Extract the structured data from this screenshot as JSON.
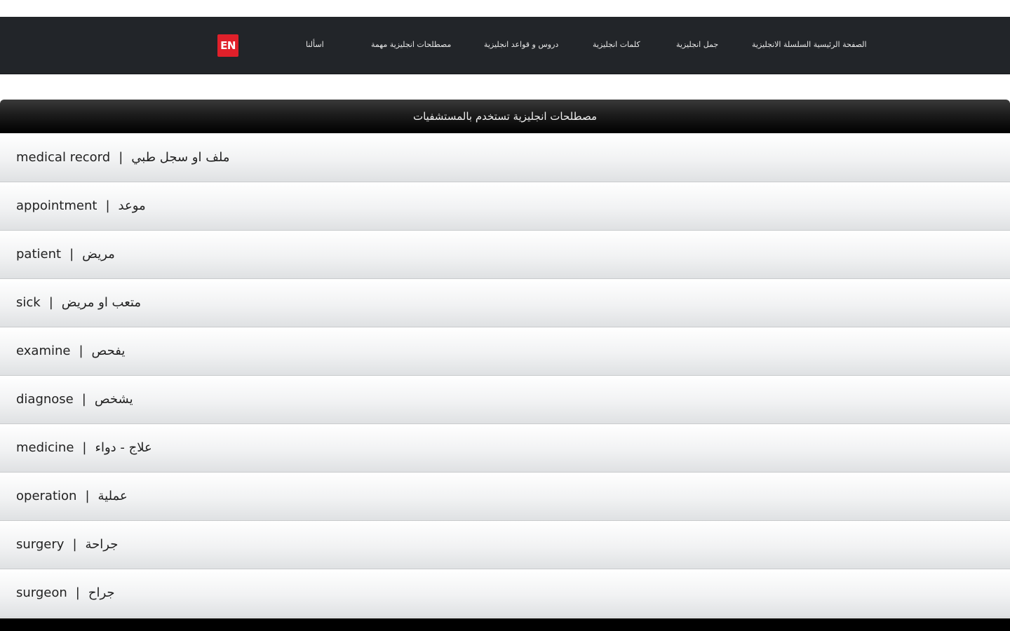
{
  "nav": {
    "logo": "EN",
    "links": [
      "اسألنا",
      "مصطلحات انجليزية مهمة",
      "دروس و قواعد انجليزية",
      "كلمات انجليزية",
      "جمل انجليزية",
      "الصفحة الرئيسية السلسلة الانجليزية"
    ]
  },
  "section": {
    "title": "مصطلحات انجليزية تستخدم بالمستشفيات"
  },
  "terms": [
    {
      "en": "medical record",
      "sep": "|",
      "ar": "ملف او سجل طبي"
    },
    {
      "en": "appointment",
      "sep": "|",
      "ar": "موعد"
    },
    {
      "en": "patient",
      "sep": "|",
      "ar": "مريض"
    },
    {
      "en": "sick",
      "sep": "|",
      "ar": "متعب او مريض"
    },
    {
      "en": "examine",
      "sep": "|",
      "ar": "يفحص"
    },
    {
      "en": "diagnose",
      "sep": "|",
      "ar": "يشخص"
    },
    {
      "en": "medicine",
      "sep": "|",
      "ar": "علاج - دواء"
    },
    {
      "en": "operation",
      "sep": "|",
      "ar": "عملية"
    },
    {
      "en": "surgery",
      "sep": "|",
      "ar": "جراحة"
    },
    {
      "en": "surgeon",
      "sep": "|",
      "ar": "جراح"
    }
  ],
  "colors": {
    "navbar": "#222529",
    "logo": "#e0202a",
    "header_dark": "#000000"
  }
}
